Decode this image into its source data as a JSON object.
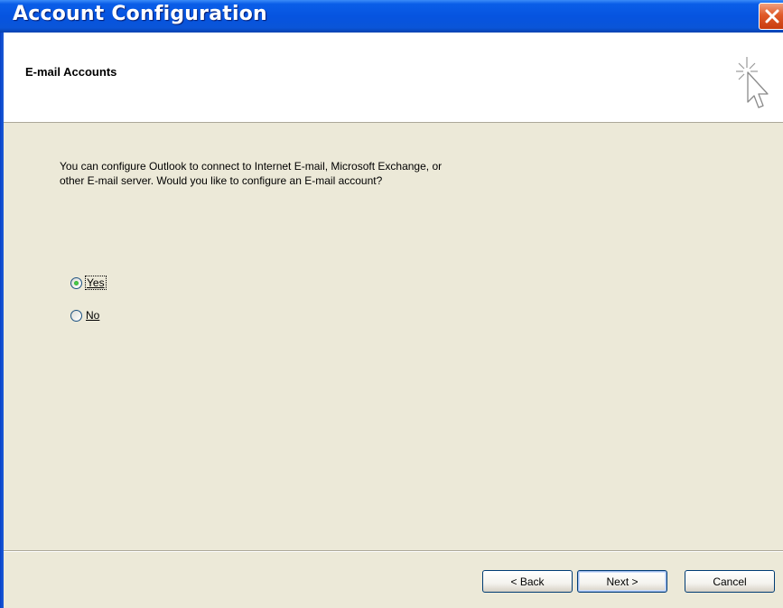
{
  "window": {
    "title": "Account Configuration",
    "close_icon": "close-icon"
  },
  "header": {
    "title": "E-mail Accounts",
    "icon": "wizard-cursor-icon"
  },
  "content": {
    "description_line1": "You can configure Outlook to connect to Internet E-mail, Microsoft Exchange, or",
    "description_line2": "other E-mail server. Would you like to configure an E-mail account?",
    "options": [
      {
        "label": "Yes",
        "selected": true
      },
      {
        "label": "No",
        "selected": false
      }
    ]
  },
  "footer": {
    "back_label": "< Back",
    "next_label": "Next >",
    "cancel_label": "Cancel"
  },
  "colors": {
    "titlebar": "#0654e0",
    "dialog_bg": "#ece9d8",
    "close": "#e05a28",
    "radio_dot": "#21a121"
  }
}
